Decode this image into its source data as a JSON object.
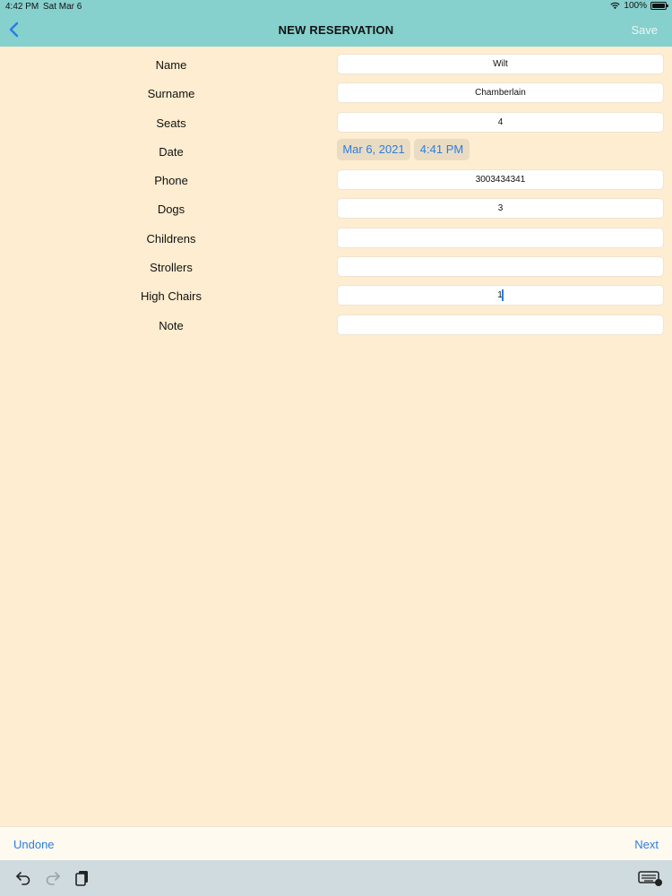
{
  "status_bar": {
    "time": "4:42 PM",
    "date": "Sat Mar 6",
    "battery": "100%"
  },
  "nav": {
    "title": "NEW RESERVATION",
    "save_label": "Save",
    "back_icon": "chevron-left-icon"
  },
  "form": {
    "name": {
      "label": "Name",
      "value": "Wilt"
    },
    "surname": {
      "label": "Surname",
      "value": "Chamberlain"
    },
    "seats": {
      "label": "Seats",
      "value": "4"
    },
    "date": {
      "label": "Date",
      "date_value": "Mar 6, 2021",
      "time_value": "4:41 PM"
    },
    "phone": {
      "label": "Phone",
      "value": "3003434341"
    },
    "dogs": {
      "label": "Dogs",
      "value": "3"
    },
    "childrens": {
      "label": "Childrens",
      "value": ""
    },
    "strollers": {
      "label": "Strollers",
      "value": ""
    },
    "high_chairs": {
      "label": "High Chairs",
      "value": "1"
    },
    "note": {
      "label": "Note",
      "value": ""
    }
  },
  "accessory": {
    "undone_label": "Undone",
    "next_label": "Next"
  },
  "keyboard_bar": {
    "icons": [
      "undo-icon",
      "redo-icon",
      "paste-icon",
      "keyboard-dismiss-icon"
    ]
  },
  "colors": {
    "nav_bg": "#86d0cd",
    "page_bg": "#feedd0",
    "accent": "#2a7de1"
  }
}
